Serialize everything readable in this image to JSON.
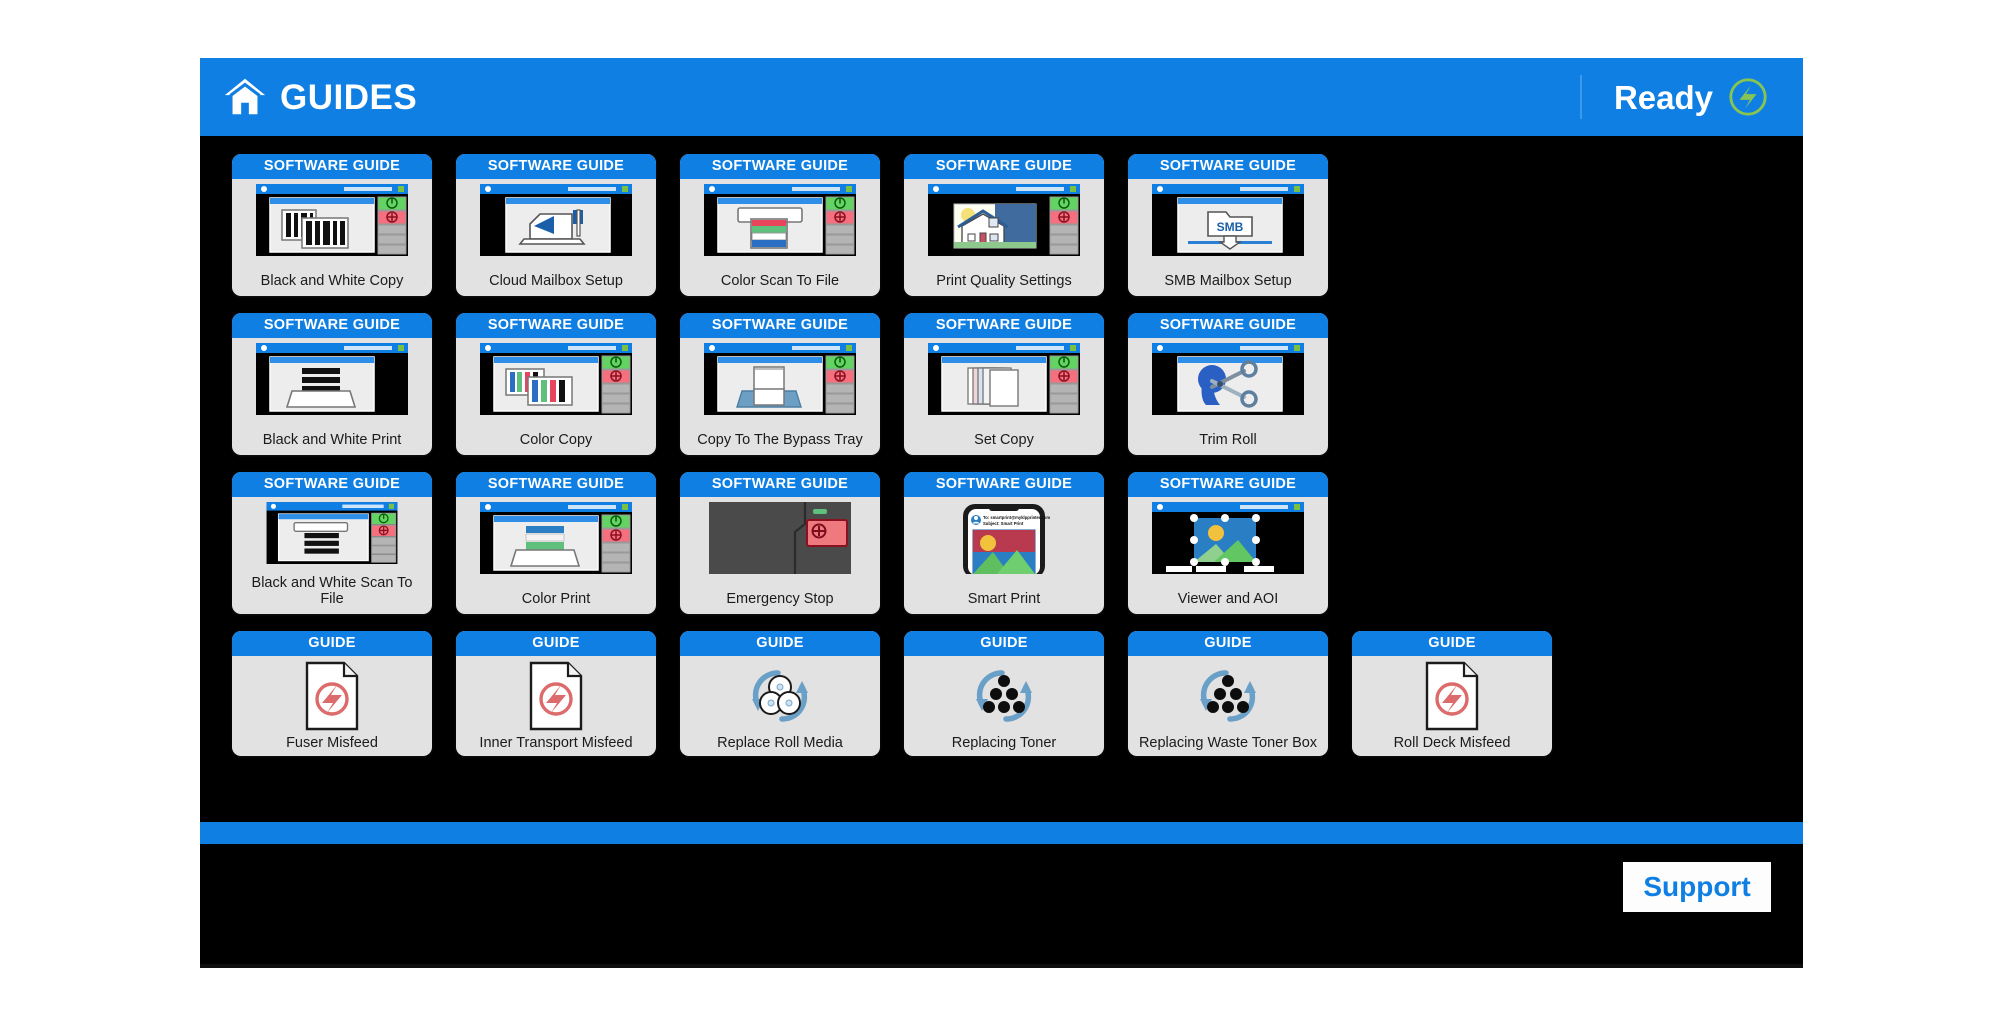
{
  "window": {
    "background_color": "#000000",
    "accent_color": "#0f7fe3",
    "card_background": "#e2e2e2"
  },
  "header": {
    "home_icon": "home-icon",
    "title": "GUIDES",
    "status_text": "Ready",
    "status_icon": "ready-bolt-icon",
    "status_icon_color": "#7ac143"
  },
  "grid": {
    "rows": [
      {
        "cards": [
          {
            "banner": "SOFTWARE GUIDE",
            "label": "Black and White Copy",
            "thumb": "panel-bw-copy"
          },
          {
            "banner": "SOFTWARE GUIDE",
            "label": "Cloud Mailbox Setup",
            "thumb": "panel-cloud-mailbox"
          },
          {
            "banner": "SOFTWARE GUIDE",
            "label": "Color Scan To File",
            "thumb": "panel-color-scan"
          },
          {
            "banner": "SOFTWARE GUIDE",
            "label": "Print Quality Settings",
            "thumb": "panel-print-quality"
          },
          {
            "banner": "SOFTWARE GUIDE",
            "label": "SMB Mailbox Setup",
            "thumb": "panel-smb-mailbox"
          }
        ]
      },
      {
        "cards": [
          {
            "banner": "SOFTWARE GUIDE",
            "label": "Black and White Print",
            "thumb": "panel-bw-print"
          },
          {
            "banner": "SOFTWARE GUIDE",
            "label": "Color Copy",
            "thumb": "panel-color-copy"
          },
          {
            "banner": "SOFTWARE GUIDE",
            "label": "Copy To The Bypass Tray",
            "thumb": "panel-bypass-tray"
          },
          {
            "banner": "SOFTWARE GUIDE",
            "label": "Set Copy",
            "thumb": "panel-set-copy"
          },
          {
            "banner": "SOFTWARE GUIDE",
            "label": "Trim Roll",
            "thumb": "panel-trim-roll"
          }
        ]
      },
      {
        "cards": [
          {
            "banner": "SOFTWARE GUIDE",
            "label": "Black and White Scan To File",
            "thumb": "panel-bw-scan"
          },
          {
            "banner": "SOFTWARE GUIDE",
            "label": "Color Print",
            "thumb": "panel-color-print"
          },
          {
            "banner": "SOFTWARE GUIDE",
            "label": "Emergency Stop",
            "thumb": "panel-emergency-stop"
          },
          {
            "banner": "SOFTWARE GUIDE",
            "label": "Smart Print",
            "thumb": "panel-smart-print"
          },
          {
            "banner": "SOFTWARE GUIDE",
            "label": "Viewer and AOI",
            "thumb": "panel-viewer-aoi"
          }
        ]
      },
      {
        "cards": [
          {
            "banner": "GUIDE",
            "label": "Fuser Misfeed",
            "thumb": "doc-misfeed-icon"
          },
          {
            "banner": "GUIDE",
            "label": "Inner Transport Misfeed",
            "thumb": "doc-misfeed-icon"
          },
          {
            "banner": "GUIDE",
            "label": "Replace Roll Media",
            "thumb": "replace-roll-icon"
          },
          {
            "banner": "GUIDE",
            "label": "Replacing Toner",
            "thumb": "replace-toner-icon"
          },
          {
            "banner": "GUIDE",
            "label": "Replacing Waste Toner Box",
            "thumb": "replace-toner-icon"
          },
          {
            "banner": "GUIDE",
            "label": "Roll Deck Misfeed",
            "thumb": "doc-misfeed-icon"
          }
        ]
      }
    ]
  },
  "smart_print_email": {
    "to_line": "To: smartprint@myklpprinter.com",
    "subject_line": "Subject: Smart Print"
  },
  "footer": {
    "support_label": "Support"
  }
}
